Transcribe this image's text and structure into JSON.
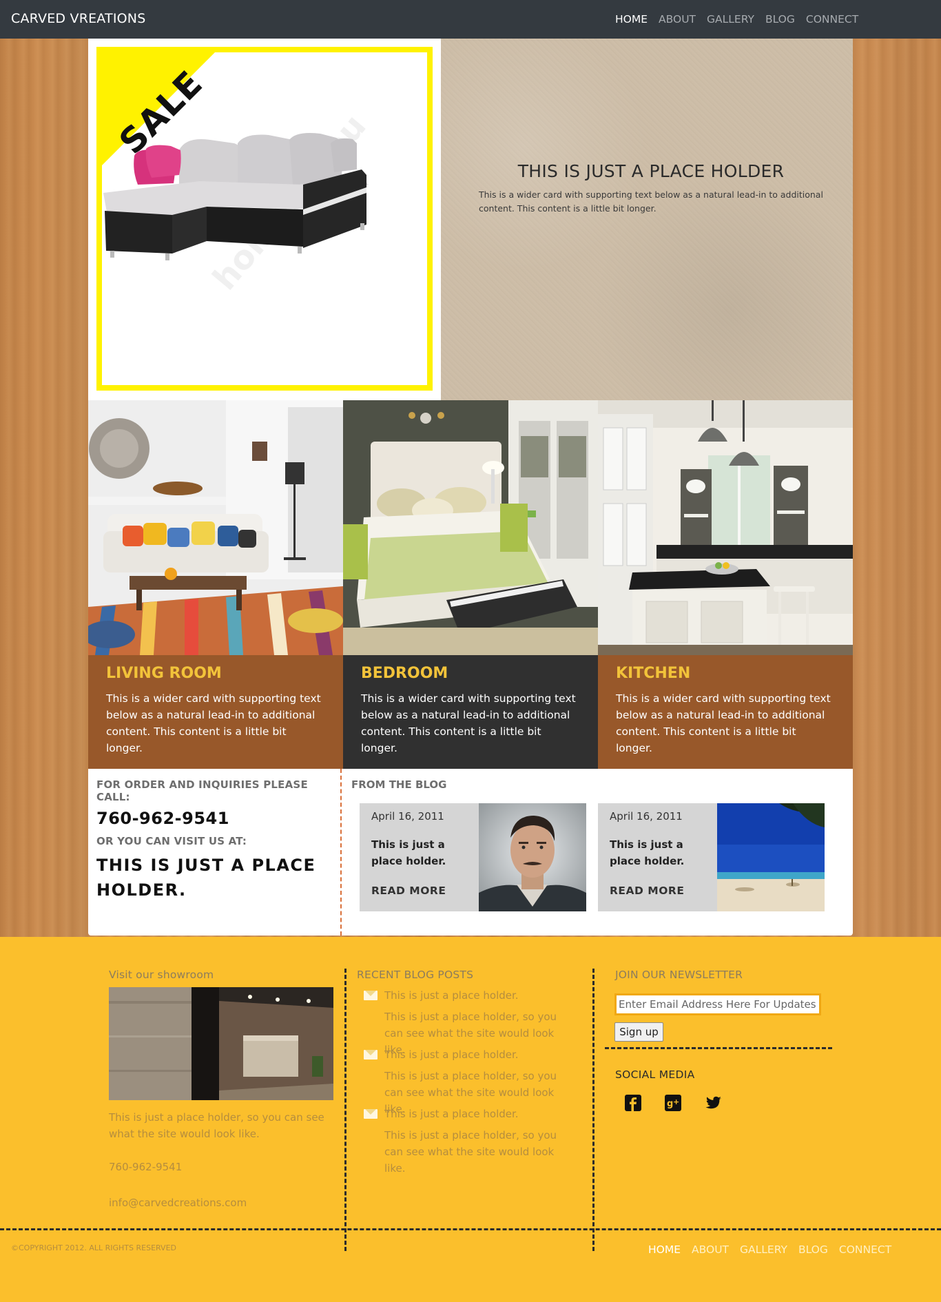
{
  "nav": {
    "brand": "CARVED VREATIONS",
    "links": [
      "HOME",
      "ABOUT",
      "GALLERY",
      "BLOG",
      "CONNECT"
    ],
    "active": "HOME"
  },
  "hero": {
    "sale_badge": "SALE",
    "watermark": "homebyyou",
    "title": "THIS IS JUST A PLACE HOLDER",
    "description": "This is a wider card with supporting text below as a natural lead-in to additional content. This content is a little bit longer."
  },
  "rooms": [
    {
      "title": "LIVING ROOM",
      "description": "This is a wider card with supporting text below as a natural lead-in to additional content. This content is a little bit longer."
    },
    {
      "title": "BEDROOM",
      "description": "This is a wider card with supporting text below as a natural lead-in to additional content. This content is a little bit longer."
    },
    {
      "title": "KITCHEN",
      "description": "This is a wider card with supporting text below as a natural lead-in to additional content. This content is a little bit longer."
    }
  ],
  "contact": {
    "order_label": "FOR ORDER AND INQUIRIES PLEASE CALL:",
    "phone": "760-962-9541",
    "visit_label": "OR YOU CAN VISIT US AT:",
    "address": "THIS IS JUST A PLACE HOLDER."
  },
  "blog": {
    "heading": "FROM THE BLOG",
    "posts": [
      {
        "date": "April 16, 2011",
        "title": "This is just a place holder.",
        "more": "READ MORE"
      },
      {
        "date": "April 16, 2011",
        "title": "This is just a place holder.",
        "more": "READ MORE"
      }
    ]
  },
  "footer": {
    "showroom_label": "Visit our showroom",
    "showroom_text": "This is just a place holder, so you can see what the site would look like.",
    "phone": "760-962-9541",
    "email": "info@carvedcreations.com",
    "recent_label": "RECENT BLOG POSTS",
    "recent_posts": [
      {
        "title": "This is just a place holder.",
        "body": "This is just a place holder, so you can see what the site would look like."
      },
      {
        "title": "This is just a place holder.",
        "body": "This is just a place holder, so you can see what the site would look like."
      },
      {
        "title": "This is just a place holder.",
        "body": "This is just a place holder, so you can see what the site would look like."
      }
    ],
    "newsletter_label": "JOIN OUR NEWSLETTER",
    "newsletter_placeholder": "Enter Email Address Here For Updates",
    "signup_label": "Sign up",
    "social_label": "SOCIAL MEDIA",
    "social_icons": [
      "facebook-icon",
      "google-plus-icon",
      "twitter-icon"
    ],
    "copyright": "©COPYRIGHT 2012. ALL RIGHTS RESERVED",
    "nav": [
      "HOME",
      "ABOUT",
      "GALLERY",
      "BLOG",
      "CONNECT"
    ]
  },
  "colors": {
    "nav_bg": "#343a40",
    "sale_yellow": "#fff200",
    "room_brown": "#98582a",
    "room_dark": "#303030",
    "room_title": "#f2c33a",
    "footer_bg": "#fbbf2c"
  }
}
